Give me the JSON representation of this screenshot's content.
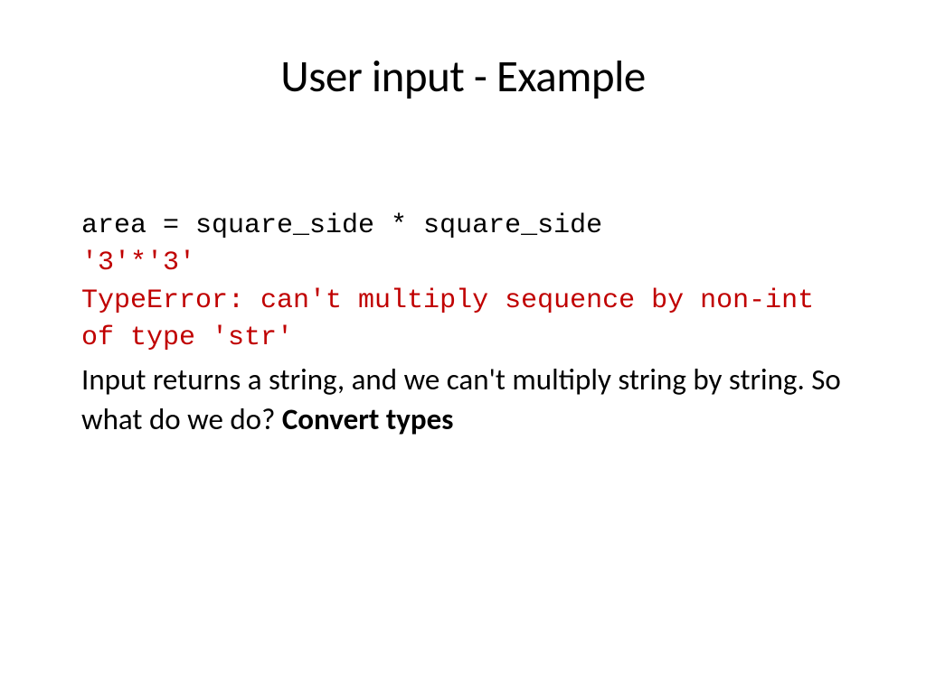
{
  "title": "User input - Example",
  "code_line1": "area = square_side * square_side",
  "error_line1": "'3'*'3'",
  "error_line2": "TypeError: can't multiply sequence by non-int of type 'str'",
  "body_text_normal": "Input returns a string, and we can't multiply string by string. So what do we do? ",
  "body_text_bold": "Convert types"
}
